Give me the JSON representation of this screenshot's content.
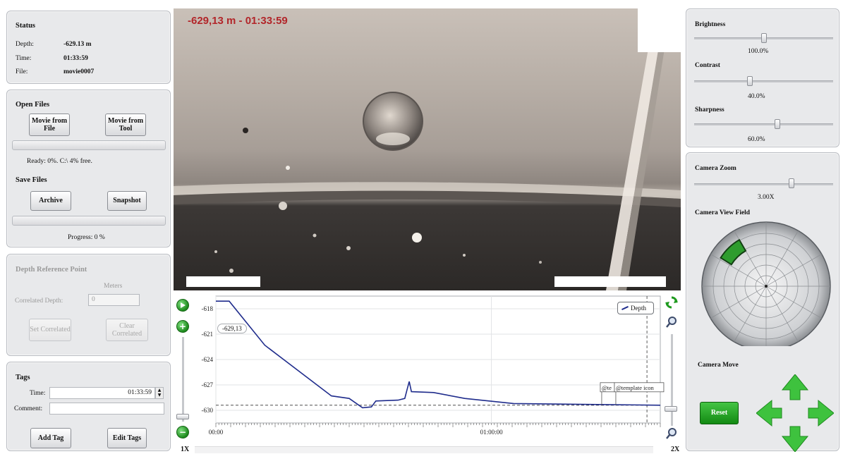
{
  "status": {
    "title": "Status",
    "depth_label": "Depth:",
    "depth_value": "-629.13 m",
    "time_label": "Time:",
    "time_value": "01:33:59",
    "file_label": "File:",
    "file_value": "movie0007"
  },
  "open_files": {
    "title": "Open Files",
    "movie_from_file": "Movie from File",
    "movie_from_tool": "Movie from Tool",
    "ready_text": "Ready: 0%. C:\\ 4% free.",
    "save_title": "Save Files",
    "archive": "Archive",
    "snapshot": "Snapshot",
    "progress_text": "Progress: 0 %",
    "progress_value": 0
  },
  "depth_ref": {
    "title": "Depth Reference Point",
    "meters_label": "Meters",
    "correlated_label": "Correlated Depth:",
    "correlated_value": "0",
    "set_correlated": "Set Correlated",
    "clear_correlated": "Clear Correlated"
  },
  "tags": {
    "title": "Tags",
    "time_label": "Time:",
    "time_value": "01:33:59",
    "comment_label": "Comment:",
    "comment_value": "",
    "add_tag": "Add Tag",
    "edit_tags": "Edit Tags"
  },
  "video": {
    "overlay": "-629,13 m - 01:33:59",
    "overlay_color": "#b2262a"
  },
  "chart_data": {
    "type": "line",
    "series": [
      {
        "name": "Depth",
        "points": [
          [
            0,
            -617.1
          ],
          [
            3,
            -617.1
          ],
          [
            11,
            -622.3
          ],
          [
            26,
            -628.3
          ],
          [
            30,
            -628.6
          ],
          [
            33,
            -629.7
          ],
          [
            35,
            -629.6
          ],
          [
            36,
            -628.9
          ],
          [
            41,
            -628.8
          ],
          [
            42.5,
            -628.6
          ],
          [
            43,
            -627.6
          ],
          [
            43.5,
            -626.6
          ],
          [
            44,
            -627.8
          ],
          [
            49,
            -627.9
          ],
          [
            56,
            -628.6
          ],
          [
            67,
            -629.2
          ],
          [
            100,
            -629.4
          ]
        ]
      }
    ],
    "ylim": [
      -631.5,
      -616.5
    ],
    "yticks": [
      -618,
      -621,
      -624,
      -627,
      -630
    ],
    "xticks": [
      {
        "pos": 0,
        "label": "00:00"
      },
      {
        "pos": 62,
        "label": "01:00:00"
      }
    ],
    "reference_line": -629.4,
    "cursor_label": "-629,13",
    "legend": "Depth",
    "tag_labels": [
      "@te",
      "@template icon"
    ],
    "series_color": "#1f2c8c",
    "scale_min_label": "1X",
    "scale_max_label": "2X"
  },
  "image_controls": {
    "brightness_label": "Brightness",
    "brightness_value": "100.0%",
    "brightness": 0.5,
    "contrast_label": "Contrast",
    "contrast_value": "40.0%",
    "contrast": 0.4,
    "sharpness_label": "Sharpness",
    "sharpness_value": "60.0%",
    "sharpness": 0.6
  },
  "camera": {
    "zoom_label": "Camera Zoom",
    "zoom_value": "3.00X",
    "zoom": 0.7,
    "view_field_label": "Camera View Field",
    "move_label": "Camera Move",
    "reset": "Reset",
    "accent": "#1f9a1f"
  }
}
